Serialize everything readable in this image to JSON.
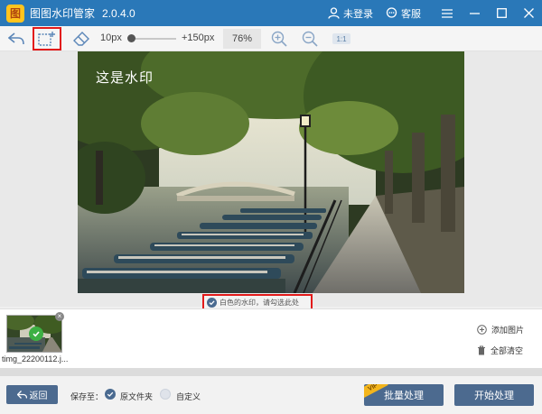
{
  "app": {
    "title": "图图水印管家",
    "version": "2.0.4.0",
    "logo_char": "图",
    "login_label": "未登录",
    "service_label": "客服"
  },
  "toolbar": {
    "size_min": "10px",
    "size_max": "+150px",
    "zoom": "76%",
    "ratio_label": "1:1",
    "brush_size_fraction": 0.0
  },
  "canvas": {
    "watermark_text": "这是水印",
    "notice_text": "白色的水印，请勾选此处"
  },
  "thumbnails": [
    {
      "name": "timg_22200112.j..."
    }
  ],
  "side_actions": {
    "add_image": "添加图片",
    "clear_all": "全部清空"
  },
  "bottom": {
    "back_label": "返回",
    "save_to_label": "保存至：",
    "option_original": "原文件夹",
    "option_custom": "自定义",
    "vip_badge": "VIP",
    "batch_label": "批量处理",
    "start_label": "开始处理"
  },
  "colors": {
    "titlebar": "#2a78b8",
    "primary_button": "#4c6a8f",
    "highlight_border": "#e21a1a",
    "check_green": "#3cb043"
  }
}
